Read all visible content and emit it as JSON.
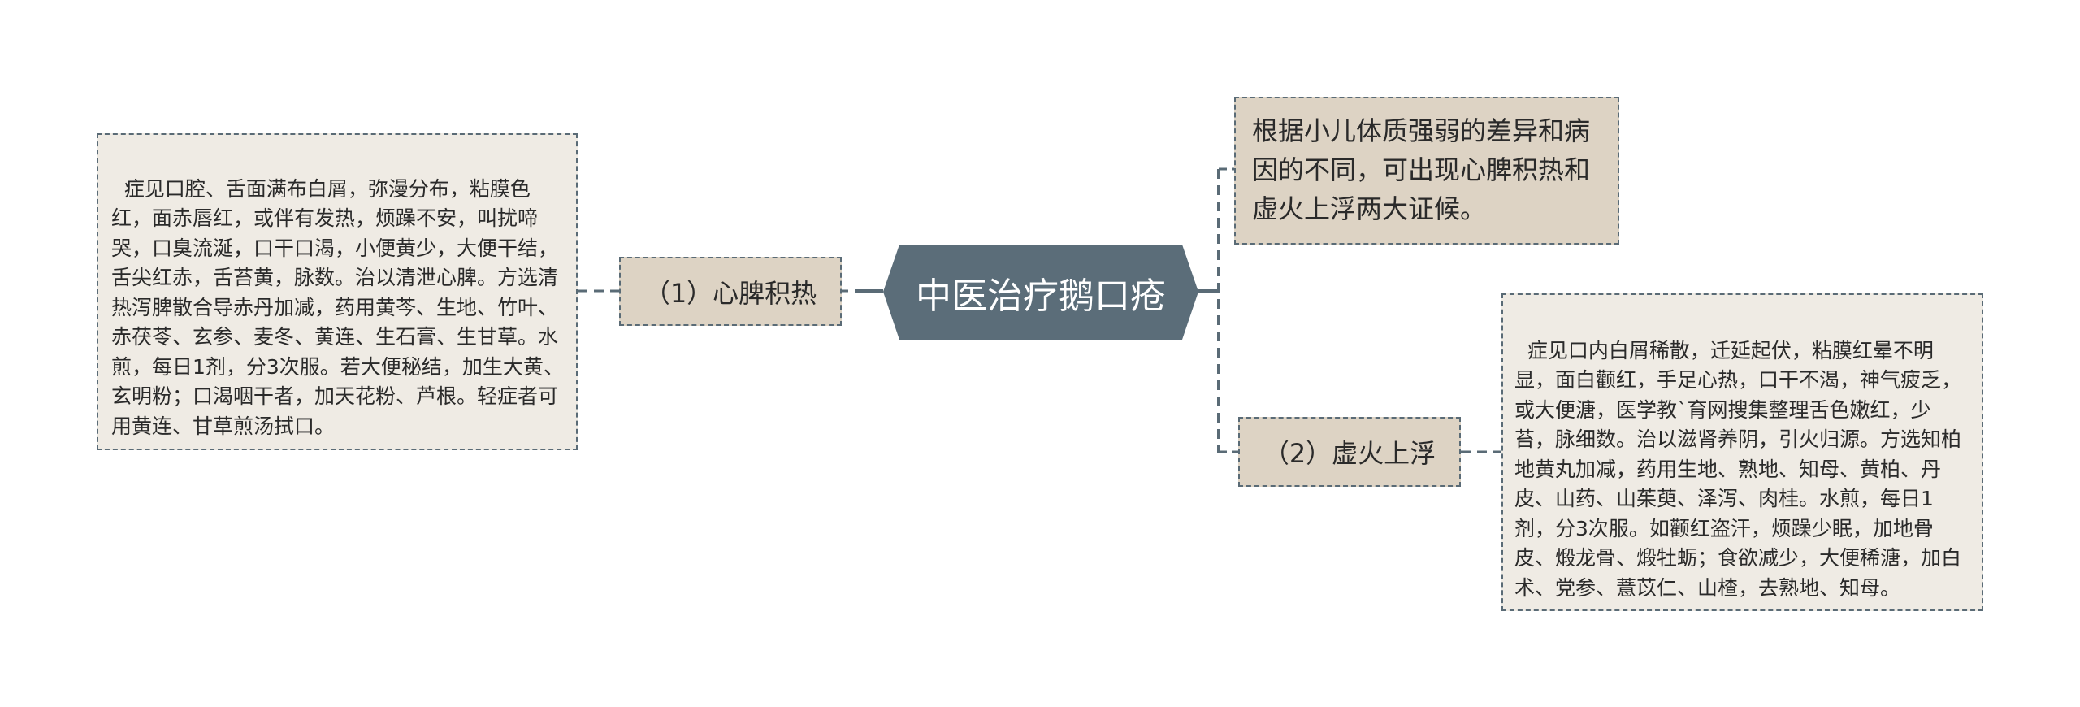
{
  "central": {
    "title": "中医治疗鹅口疮"
  },
  "branches": [
    {
      "label": "（1）心脾积热"
    },
    {
      "label": "（2）虚火上浮"
    }
  ],
  "summary": {
    "text": "根据小儿体质强弱的差异和病因的不同，可出现心脾积热和虚火上浮两大证候。"
  },
  "details": {
    "heart_spleen": "症见口腔、舌面满布白屑，弥漫分布，粘膜色红，面赤唇红，或伴有发热，烦躁不安，叫扰啼哭，口臭流涎，口干口渴，小便黄少，大便干结，舌尖红赤，舌苔黄，脉数。治以清泄心脾。方选清热泻脾散合导赤丹加减，药用黄芩、生地、竹叶、赤茯苓、玄参、麦冬、黄连、生石膏、生甘草。水煎，每日1剂，分3次服。若大便秘结，加生大黄、玄明粉；口渴咽干者，加天花粉、芦根。轻症者可用黄连、甘草煎汤拭口。",
    "deficient_fire": "症见口内白屑稀散，迁延起伏，粘膜红晕不明显，面白颧红，手足心热，口干不渴，神气疲乏，或大便溏，医学教`育网搜集整理舌色嫩红，少苔，脉细数。治以滋肾养阴，引火归源。方选知柏地黄丸加减，药用生地、熟地、知母、黄柏、丹皮、山药、山茱萸、泽泻、肉桂。水煎，每日1剂，分3次服。如颧红盗汗，烦躁少眠，加地骨皮、煅龙骨、煅牡蛎；食欲减少，大便稀溏，加白术、党参、薏苡仁、山楂，去熟地、知母。"
  },
  "colors": {
    "central_fill": "#5b6d79",
    "branch_fill": "#ddd3c4",
    "leaf_fill": "#efebe4",
    "line": "#5a6b76"
  }
}
